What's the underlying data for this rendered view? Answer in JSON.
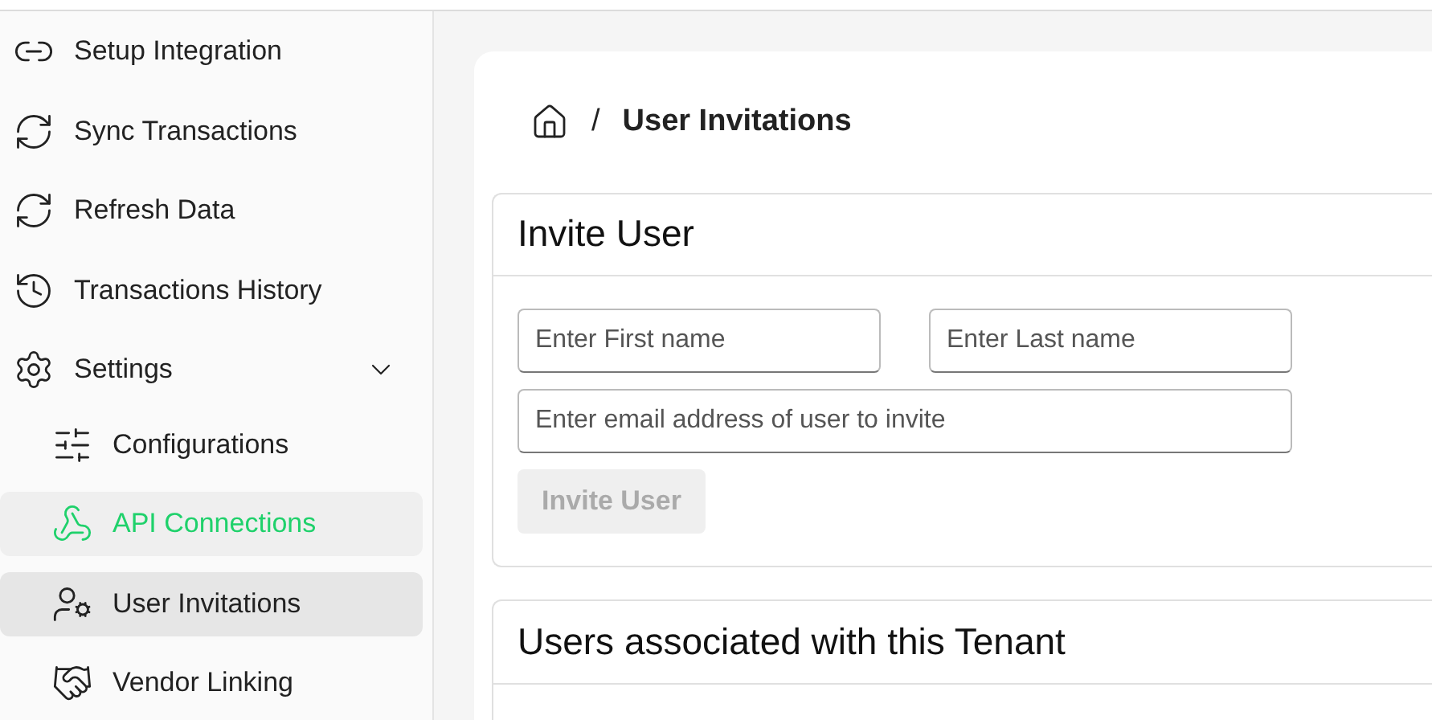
{
  "sidebar": {
    "items": [
      {
        "label": "Setup Integration",
        "selected": false,
        "hovered": false
      },
      {
        "label": "Sync Transactions",
        "selected": false,
        "hovered": false
      },
      {
        "label": "Refresh Data",
        "selected": false,
        "hovered": false
      },
      {
        "label": "Transactions History",
        "selected": false,
        "hovered": false
      },
      {
        "label": "Settings",
        "selected": false,
        "hovered": false,
        "expanded": true,
        "children": [
          {
            "label": "Configurations",
            "selected": false,
            "hovered": false
          },
          {
            "label": "API Connections",
            "selected": false,
            "hovered": true
          },
          {
            "label": "User Invitations",
            "selected": true,
            "hovered": false
          },
          {
            "label": "Vendor Linking",
            "selected": false,
            "hovered": false
          }
        ]
      }
    ]
  },
  "breadcrumb": {
    "separator": "/",
    "current": "User Invitations"
  },
  "invite_panel": {
    "title": "Invite User",
    "first_name": {
      "placeholder": "Enter First name"
    },
    "last_name": {
      "placeholder": "Enter Last name"
    },
    "email": {
      "placeholder": "Enter email address of user to invite"
    },
    "button": {
      "label": "Invite User",
      "disabled": true
    }
  },
  "users_panel": {
    "title": "Users associated with this Tenant"
  }
}
